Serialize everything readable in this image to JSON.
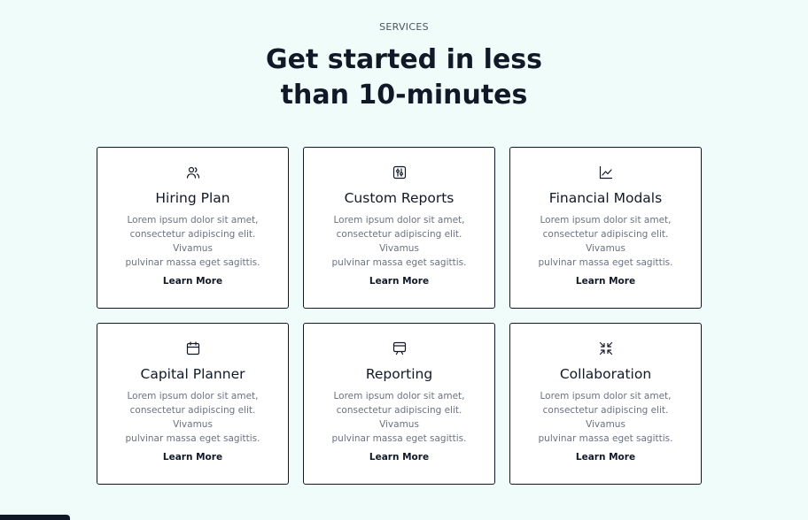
{
  "header": {
    "eyebrow": "SERVICES",
    "title_line1": "Get started in less",
    "title_line2": "than 10-minutes"
  },
  "cards": [
    {
      "icon": "users-icon",
      "title": "Hiring Plan",
      "desc_line1": "Lorem ipsum dolor sit amet,",
      "desc_line2": "consectetur adipiscing elit. Vivamus",
      "desc_line3": "pulvinar massa eget sagittis.",
      "link": "Learn More"
    },
    {
      "icon": "sliders-icon",
      "title": "Custom Reports",
      "desc_line1": "Lorem ipsum dolor sit amet,",
      "desc_line2": "consectetur adipiscing elit. Vivamus",
      "desc_line3": "pulvinar massa eget sagittis.",
      "link": "Learn More"
    },
    {
      "icon": "line-chart-icon",
      "title": "Financial Modals",
      "desc_line1": "Lorem ipsum dolor sit amet,",
      "desc_line2": "consectetur adipiscing elit. Vivamus",
      "desc_line3": "pulvinar massa eget sagittis.",
      "link": "Learn More"
    },
    {
      "icon": "calendar-icon",
      "title": "Capital Planner",
      "desc_line1": "Lorem ipsum dolor sit amet,",
      "desc_line2": "consectetur adipiscing elit. Vivamus",
      "desc_line3": "pulvinar massa eget sagittis.",
      "link": "Learn More"
    },
    {
      "icon": "presentation-icon",
      "title": "Reporting",
      "desc_line1": "Lorem ipsum dolor sit amet,",
      "desc_line2": "consectetur adipiscing elit. Vivamus",
      "desc_line3": "pulvinar massa eget sagittis.",
      "link": "Learn More"
    },
    {
      "icon": "shrink-icon",
      "title": "Collaboration",
      "desc_line1": "Lorem ipsum dolor sit amet,",
      "desc_line2": "consectetur adipiscing elit. Vivamus",
      "desc_line3": "pulvinar massa eget sagittis.",
      "link": "Learn More"
    }
  ],
  "colors": {
    "background": "#effcf9",
    "text": "#111827",
    "muted": "#6b7280",
    "card": "#ffffff"
  }
}
